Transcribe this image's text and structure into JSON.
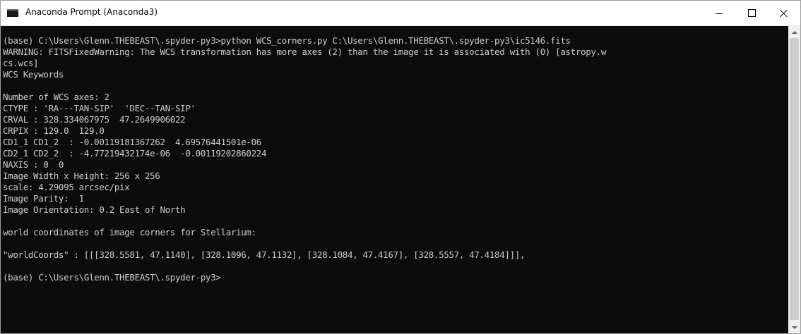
{
  "window": {
    "title": "Anaconda Prompt (Anaconda3)",
    "icon": "console-icon"
  },
  "console": {
    "lines": [
      "(base) C:\\Users\\Glenn.THEBEAST\\.spyder-py3>python WCS_corners.py C:\\Users\\Glenn.THEBEAST\\.spyder-py3\\ic5146.fits",
      "WARNING: FITSFixedWarning: The WCS transformation has more axes (2) than the image it is associated with (0) [astropy.w",
      "cs.wcs]",
      "WCS Keywords",
      "",
      "Number of WCS axes: 2",
      "CTYPE : 'RA---TAN-SIP'  'DEC--TAN-SIP'",
      "CRVAL : 328.334067975  47.2649906022",
      "CRPIX : 129.0  129.0",
      "CD1_1 CD1_2  : -0.00119181367262  4.69576441501e-06",
      "CD2_1 CD2_2  : -4.77219432174e-06  -0.00119202860224",
      "NAXIS : 0  0",
      "Image Width x Height: 256 x 256",
      "scale: 4.29095 arcsec/pix",
      "Image Parity:  1",
      "Image Orientation: 0.2 East of North",
      "",
      "world coordinates of image corners for Stellarium:",
      "",
      "\"worldCoords\" : [[[328.5581, 47.1140], [328.1096, 47.1132], [328.1084, 47.4167], [328.5557, 47.4184]]],",
      "",
      "(base) C:\\Users\\Glenn.THEBEAST\\.spyder-py3>"
    ]
  },
  "colors": {
    "console_bg": "#0c0c0c",
    "console_text": "#cccccc",
    "titlebar_bg": "#ffffff"
  }
}
